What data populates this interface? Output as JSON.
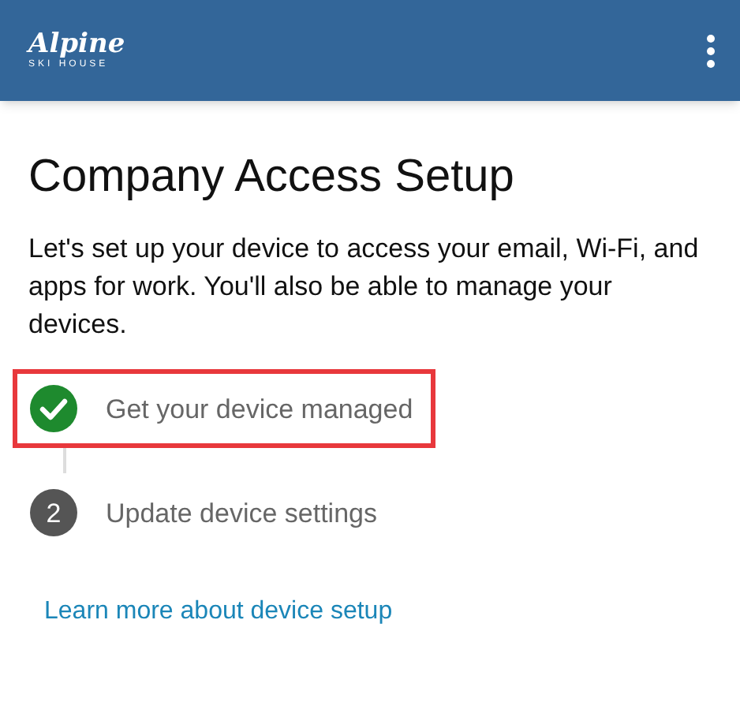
{
  "header": {
    "logo": {
      "name": "Alpine",
      "tagline": "SKI HOUSE"
    }
  },
  "title": "Company Access Setup",
  "description": "Let's set up your device to access your email, Wi-Fi, and apps for work. You'll also be able to manage your devices.",
  "steps": [
    {
      "kind": "done",
      "label": "Get your device managed",
      "highlighted": true
    },
    {
      "kind": "number",
      "number": "2",
      "label": "Update device settings",
      "highlighted": false
    }
  ],
  "link": "Learn more about device setup"
}
